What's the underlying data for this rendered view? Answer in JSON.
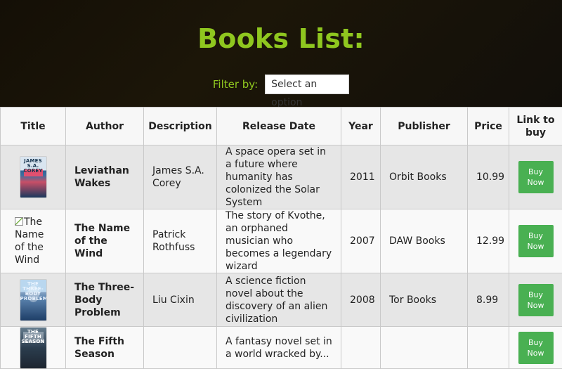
{
  "header": {
    "title": "Books List:"
  },
  "filter": {
    "label": "Filter by:",
    "selected": "Select an option"
  },
  "table": {
    "columns": [
      "Title",
      "Author",
      "Description",
      "Release Date",
      "Year",
      "Publisher",
      "Price",
      "Link to buy"
    ],
    "rows": [
      {
        "cover_label": "JAMES S.A. COREY",
        "title": "Leviathan Wakes",
        "author": "James S.A. Corey",
        "description": "A space opera set in a future where humanity has colonized the Solar System",
        "year": "2011",
        "publisher": "Orbit Books",
        "price": "10.99",
        "buy_label": "Buy Now"
      },
      {
        "cover_alt": "The Name of the Wind",
        "title": "The Name of the Wind",
        "author": "Patrick Rothfuss",
        "description": "The story of Kvothe, an orphaned musician who becomes a legendary wizard",
        "year": "2007",
        "publisher": "DAW Books",
        "price": "12.99",
        "buy_label": "Buy Now"
      },
      {
        "cover_label": "THE THREE-BODY PROBLEM",
        "title": "The Three-Body Problem",
        "author": "Liu Cixin",
        "description": "A science fiction novel about the discovery of an alien civilization",
        "year": "2008",
        "publisher": "Tor Books",
        "price": "8.99",
        "buy_label": "Buy Now"
      },
      {
        "cover_label": "THE FIFTH SEASON",
        "title": "The Fifth Season",
        "author": "",
        "description": "A fantasy novel set in a world wracked by...",
        "year": "",
        "publisher": "",
        "price": "",
        "buy_label": "Buy Now"
      }
    ]
  }
}
